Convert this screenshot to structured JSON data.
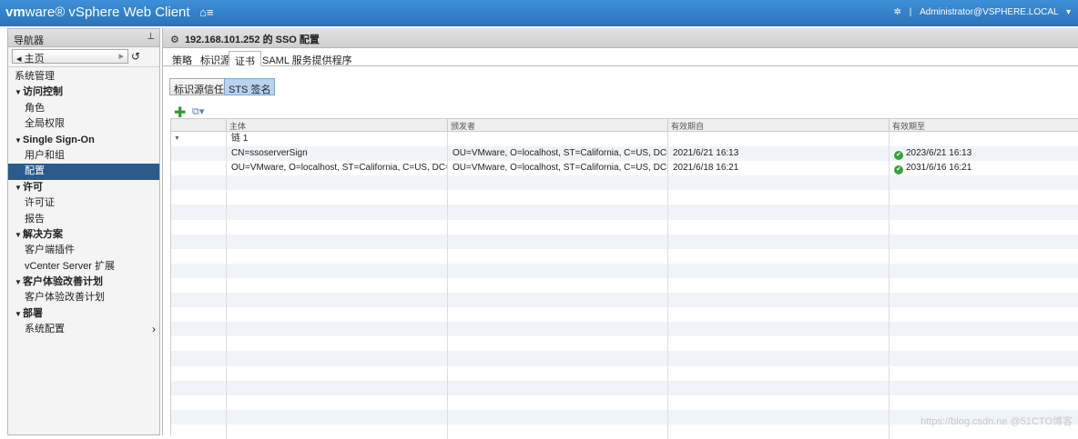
{
  "app": {
    "brand_vm": "vm",
    "brand_ware": "ware®",
    "title": " vSphere Web Client",
    "user": "Administrator@VSPHERE.LOCAL",
    "separator": "|",
    "user_caret": "▾"
  },
  "nav": {
    "header": "导航器",
    "home_label": "主页",
    "items": [
      {
        "label": "系统管理",
        "type": "root"
      },
      {
        "label": "访问控制",
        "type": "group"
      },
      {
        "label": "角色",
        "type": "child"
      },
      {
        "label": "全局权限",
        "type": "child"
      },
      {
        "label": "Single Sign-On",
        "type": "group"
      },
      {
        "label": "用户和组",
        "type": "child"
      },
      {
        "label": "配置",
        "type": "child",
        "selected": true
      },
      {
        "label": "许可",
        "type": "group"
      },
      {
        "label": "许可证",
        "type": "child"
      },
      {
        "label": "报告",
        "type": "child"
      },
      {
        "label": "解决方案",
        "type": "group"
      },
      {
        "label": "客户端插件",
        "type": "child"
      },
      {
        "label": "vCenter Server 扩展",
        "type": "child"
      },
      {
        "label": "客户体验改善计划",
        "type": "group"
      },
      {
        "label": "客户体验改善计划",
        "type": "child"
      },
      {
        "label": "部署",
        "type": "group"
      },
      {
        "label": "系统配置",
        "type": "child",
        "more": true
      }
    ]
  },
  "main": {
    "title": "192.168.101.252 的 SSO 配置",
    "tabs": [
      "策略",
      "标识源",
      "证书",
      "SAML 服务提供程序"
    ],
    "active_tab": 2,
    "subtabs": [
      "标识源信任库",
      "STS 签名"
    ],
    "active_subtab": 1
  },
  "grid": {
    "columns": [
      "主体",
      "颁发者",
      "有效期自",
      "有效期至"
    ],
    "rows": [
      {
        "subject": "链 1",
        "issuer": "",
        "from": "",
        "to": "",
        "ok": false,
        "expander": true
      },
      {
        "subject": "CN=ssoserverSign",
        "issuer": "OU=VMware, O=localhost, ST=California, C=US, DC=loc...",
        "from": "2021/6/21 16:13",
        "to": "2023/6/21 16:13",
        "ok": true
      },
      {
        "subject": "OU=VMware, O=localhost, ST=California, C=US, DC=loc...",
        "issuer": "OU=VMware, O=localhost, ST=California, C=US, DC=loc...",
        "from": "2021/6/18 16:21",
        "to": "2031/6/16 16:21",
        "ok": true
      }
    ],
    "empty_rows": 18
  },
  "watermark": "https://blog.csdn.ne  @51CTO博客"
}
